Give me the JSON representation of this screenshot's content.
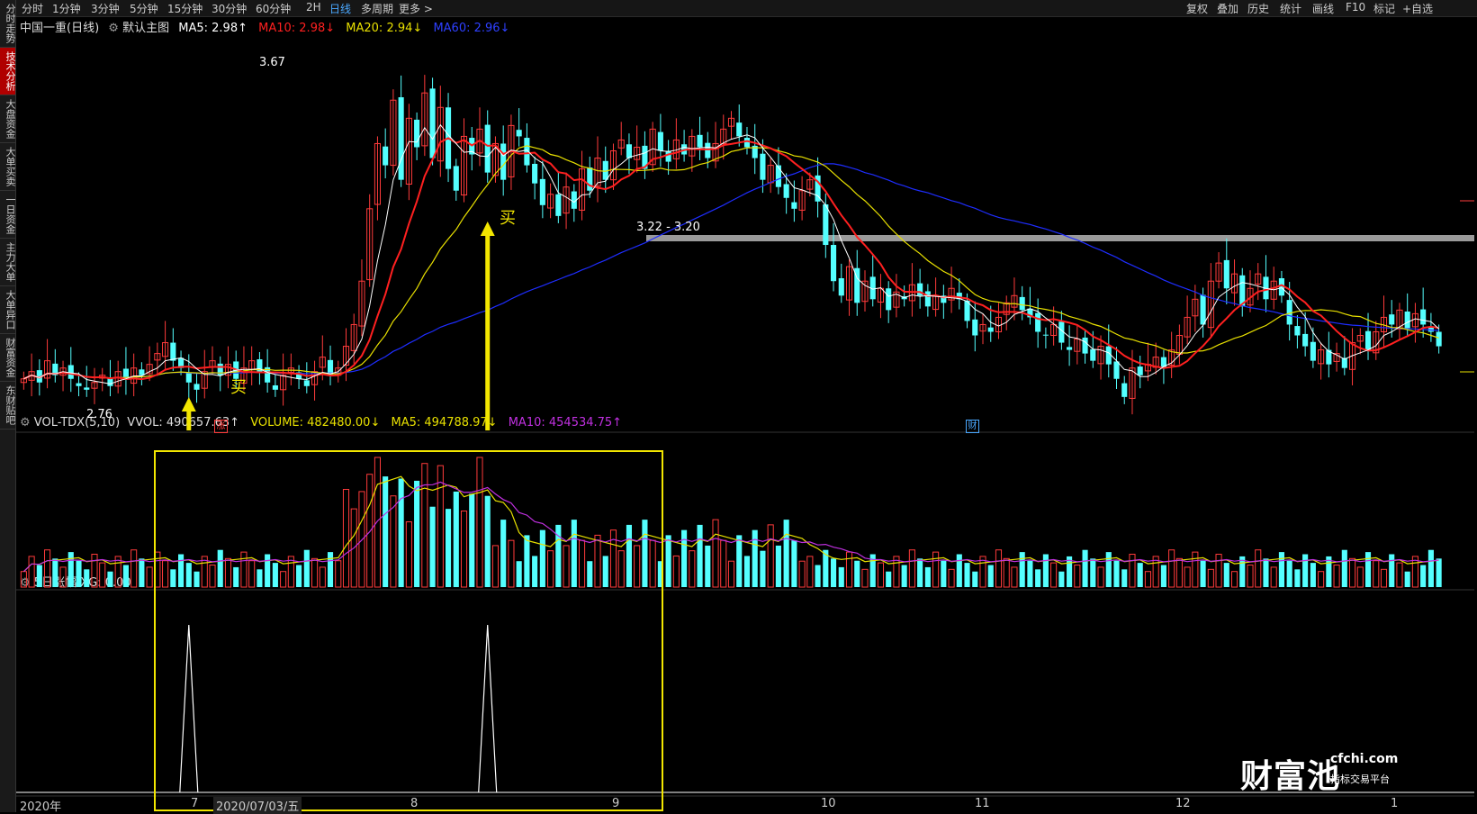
{
  "sidebar": {
    "items": [
      {
        "label": "分时走势"
      },
      {
        "label": "技术分析"
      },
      {
        "label": "大盘资金"
      },
      {
        "label": "大单买卖"
      },
      {
        "label": "一日资金"
      },
      {
        "label": "主力大单"
      },
      {
        "label": "大单异口"
      },
      {
        "label": "财富资金"
      },
      {
        "label": "东财贴吧"
      }
    ]
  },
  "toolbar": {
    "periods": [
      "分时",
      "1分钟",
      "3分钟",
      "5分钟",
      "15分钟",
      "30分钟",
      "60分钟",
      "2H",
      "日线",
      "多周期",
      "更多 >"
    ],
    "active_period": "日线",
    "right_items": [
      "复权",
      "叠加",
      "历史",
      "统计",
      "画线",
      "F10",
      "标记",
      "+自选"
    ]
  },
  "main_legend": {
    "title": "中国一重(日线)",
    "indicator": "默认主图",
    "ma5": "MA5: 2.98↑",
    "ma10": "MA10: 2.98↓",
    "ma20": "MA20: 2.94↓",
    "ma60": "MA60: 2.96↓"
  },
  "vol_legend": {
    "name": "VOL-TDX(5,10)",
    "vvol": "VVOL: 490657.63↑",
    "volume": "VOLUME: 482480.00↓",
    "ma5": "MA5: 494788.97↓",
    "ma10": "MA10: 454534.75↑"
  },
  "xg_legend": {
    "text": "5日涨幅 XG: 0.00"
  },
  "annotations": {
    "high": "3.67",
    "low": "2.76",
    "range": "3.22 - 3.20",
    "buy1": "买",
    "buy2": "买",
    "badge_zhang": "涨",
    "badge_cai": "财"
  },
  "x_axis": {
    "year": "2020年",
    "labels": [
      "7",
      "2020/07/03/五",
      "8",
      "9",
      "10",
      "11",
      "12",
      "1"
    ]
  },
  "watermark": {
    "big": "财富池",
    "site": "cfchi.com",
    "sub": "指标交易平台"
  },
  "colors": {
    "up": "#ff3b3b",
    "down": "#54ffff",
    "ma5": "#ffffff",
    "ma10": "#ff2020",
    "ma20": "#e8e000",
    "ma60": "#1e2dff",
    "box": "#f2e600",
    "vol_ma10": "#c030e0"
  },
  "chart_data": {
    "type": "candlestick",
    "y_range": [
      2.7,
      3.72
    ],
    "closes": [
      2.83,
      2.85,
      2.82,
      2.88,
      2.84,
      2.86,
      2.83,
      2.81,
      2.8,
      2.82,
      2.84,
      2.81,
      2.85,
      2.83,
      2.86,
      2.84,
      2.87,
      2.9,
      2.93,
      2.88,
      2.86,
      2.82,
      2.8,
      2.85,
      2.88,
      2.84,
      2.87,
      2.83,
      2.86,
      2.88,
      2.85,
      2.82,
      2.8,
      2.84,
      2.86,
      2.83,
      2.81,
      2.85,
      2.89,
      2.84,
      2.86,
      2.92,
      2.98,
      3.1,
      3.3,
      3.48,
      3.42,
      3.6,
      3.38,
      3.55,
      3.47,
      3.62,
      3.44,
      3.58,
      3.41,
      3.35,
      3.5,
      3.45,
      3.52,
      3.4,
      3.48,
      3.38,
      3.53,
      3.5,
      3.42,
      3.37,
      3.31,
      3.34,
      3.28,
      3.36,
      3.3,
      3.41,
      3.35,
      3.44,
      3.38,
      3.46,
      3.49,
      3.44,
      3.47,
      3.41,
      3.52,
      3.46,
      3.43,
      3.49,
      3.45,
      3.5,
      3.47,
      3.44,
      3.48,
      3.52,
      3.55,
      3.5,
      3.47,
      3.44,
      3.38,
      3.42,
      3.36,
      3.33,
      3.3,
      3.35,
      3.38,
      3.32,
      3.2,
      3.1,
      3.06,
      3.14,
      3.04,
      3.1,
      3.05,
      3.08,
      3.02,
      3.07,
      3.05,
      3.09,
      3.06,
      3.03,
      3.06,
      3.04,
      3.08,
      3.05,
      2.99,
      2.95,
      2.98,
      2.96,
      3.0,
      3.04,
      3.06,
      3.02,
      3.0,
      2.96,
      2.95,
      2.98,
      2.93,
      2.91,
      2.94,
      2.9,
      2.88,
      2.92,
      2.87,
      2.83,
      2.78,
      2.86,
      2.84,
      2.87,
      2.89,
      2.86,
      2.91,
      2.95,
      3.0,
      3.05,
      2.98,
      3.1,
      3.15,
      3.08,
      3.12,
      3.03,
      3.08,
      3.12,
      3.05,
      3.1,
      3.06,
      2.98,
      2.95,
      2.92,
      2.88,
      2.91,
      2.87,
      2.9,
      2.86,
      2.93,
      2.95,
      2.91,
      2.96,
      3.0,
      2.98,
      3.02,
      2.97,
      3.01,
      2.98,
      2.96,
      2.92
    ],
    "trend_buy_indices": [
      21,
      59
    ]
  }
}
